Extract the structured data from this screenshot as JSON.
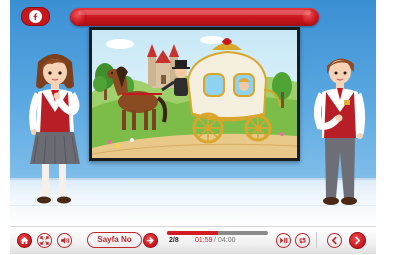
{
  "app": {
    "logo_glyph": "logo-red-pill",
    "title": ""
  },
  "toolbar": {
    "home_icon": "home-icon",
    "fullscreen_icon": "fullscreen-icon",
    "volume_icon": "volume-icon",
    "page_button_label": "Sayfa No",
    "go_icon": "arrow-right-circle-icon",
    "page_current": "2",
    "page_total": "8",
    "page_counter": "2/8",
    "time_current": "01:59",
    "time_separator": "/",
    "time_total": "04:00",
    "progress_fraction": 0.5,
    "playpause_icon": "play-pause-icon",
    "repeat_icon": "repeat-icon",
    "prev_icon": "chevron-left-icon",
    "next_icon": "chevron-right-icon"
  },
  "colors": {
    "brand_red": "#c8161d",
    "stage_blue": "#3a8fd3",
    "progress_red": "#d01c22"
  }
}
